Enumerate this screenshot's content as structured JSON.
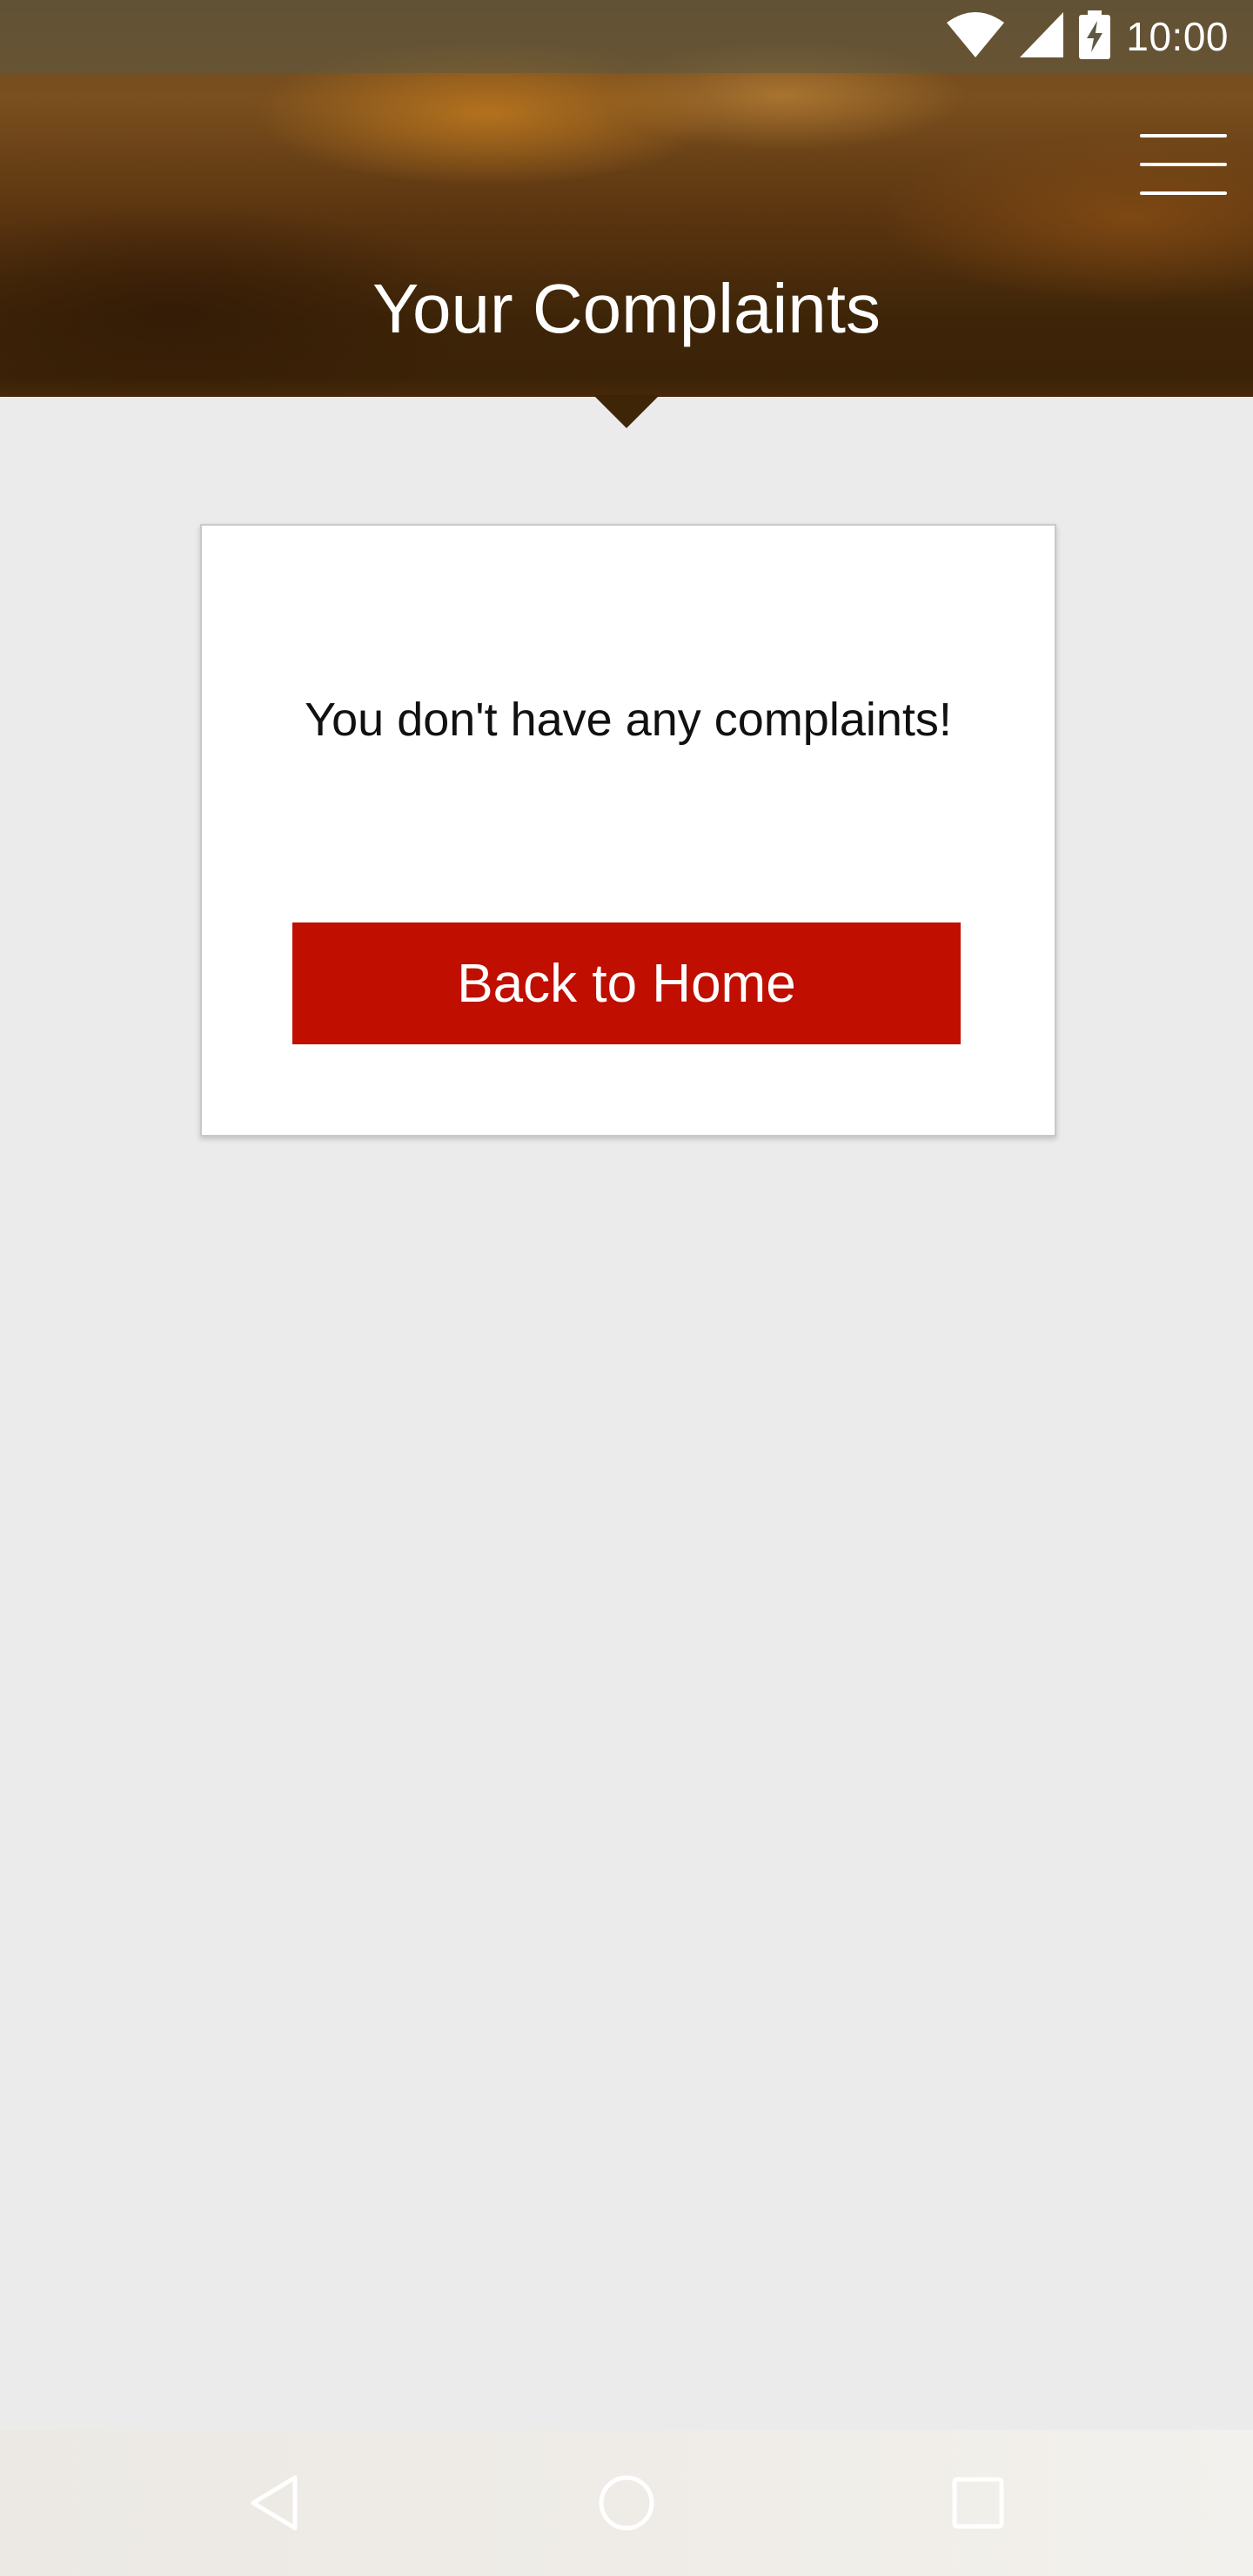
{
  "status_bar": {
    "time": "10:00",
    "icons": [
      "wifi-icon",
      "cell-signal-icon",
      "battery-charging-icon"
    ]
  },
  "header": {
    "title": "Your Complaints",
    "menu_icon": "hamburger-menu-icon"
  },
  "content": {
    "empty_message": "You don't have any complaints!",
    "back_home_label": "Back to Home"
  },
  "navigation_bar": {
    "buttons": [
      "back-icon",
      "home-icon",
      "recents-icon"
    ]
  },
  "colors": {
    "primary_button": "#c00e00",
    "page_background": "#ebebeb",
    "header_brown": "#5a3410"
  }
}
